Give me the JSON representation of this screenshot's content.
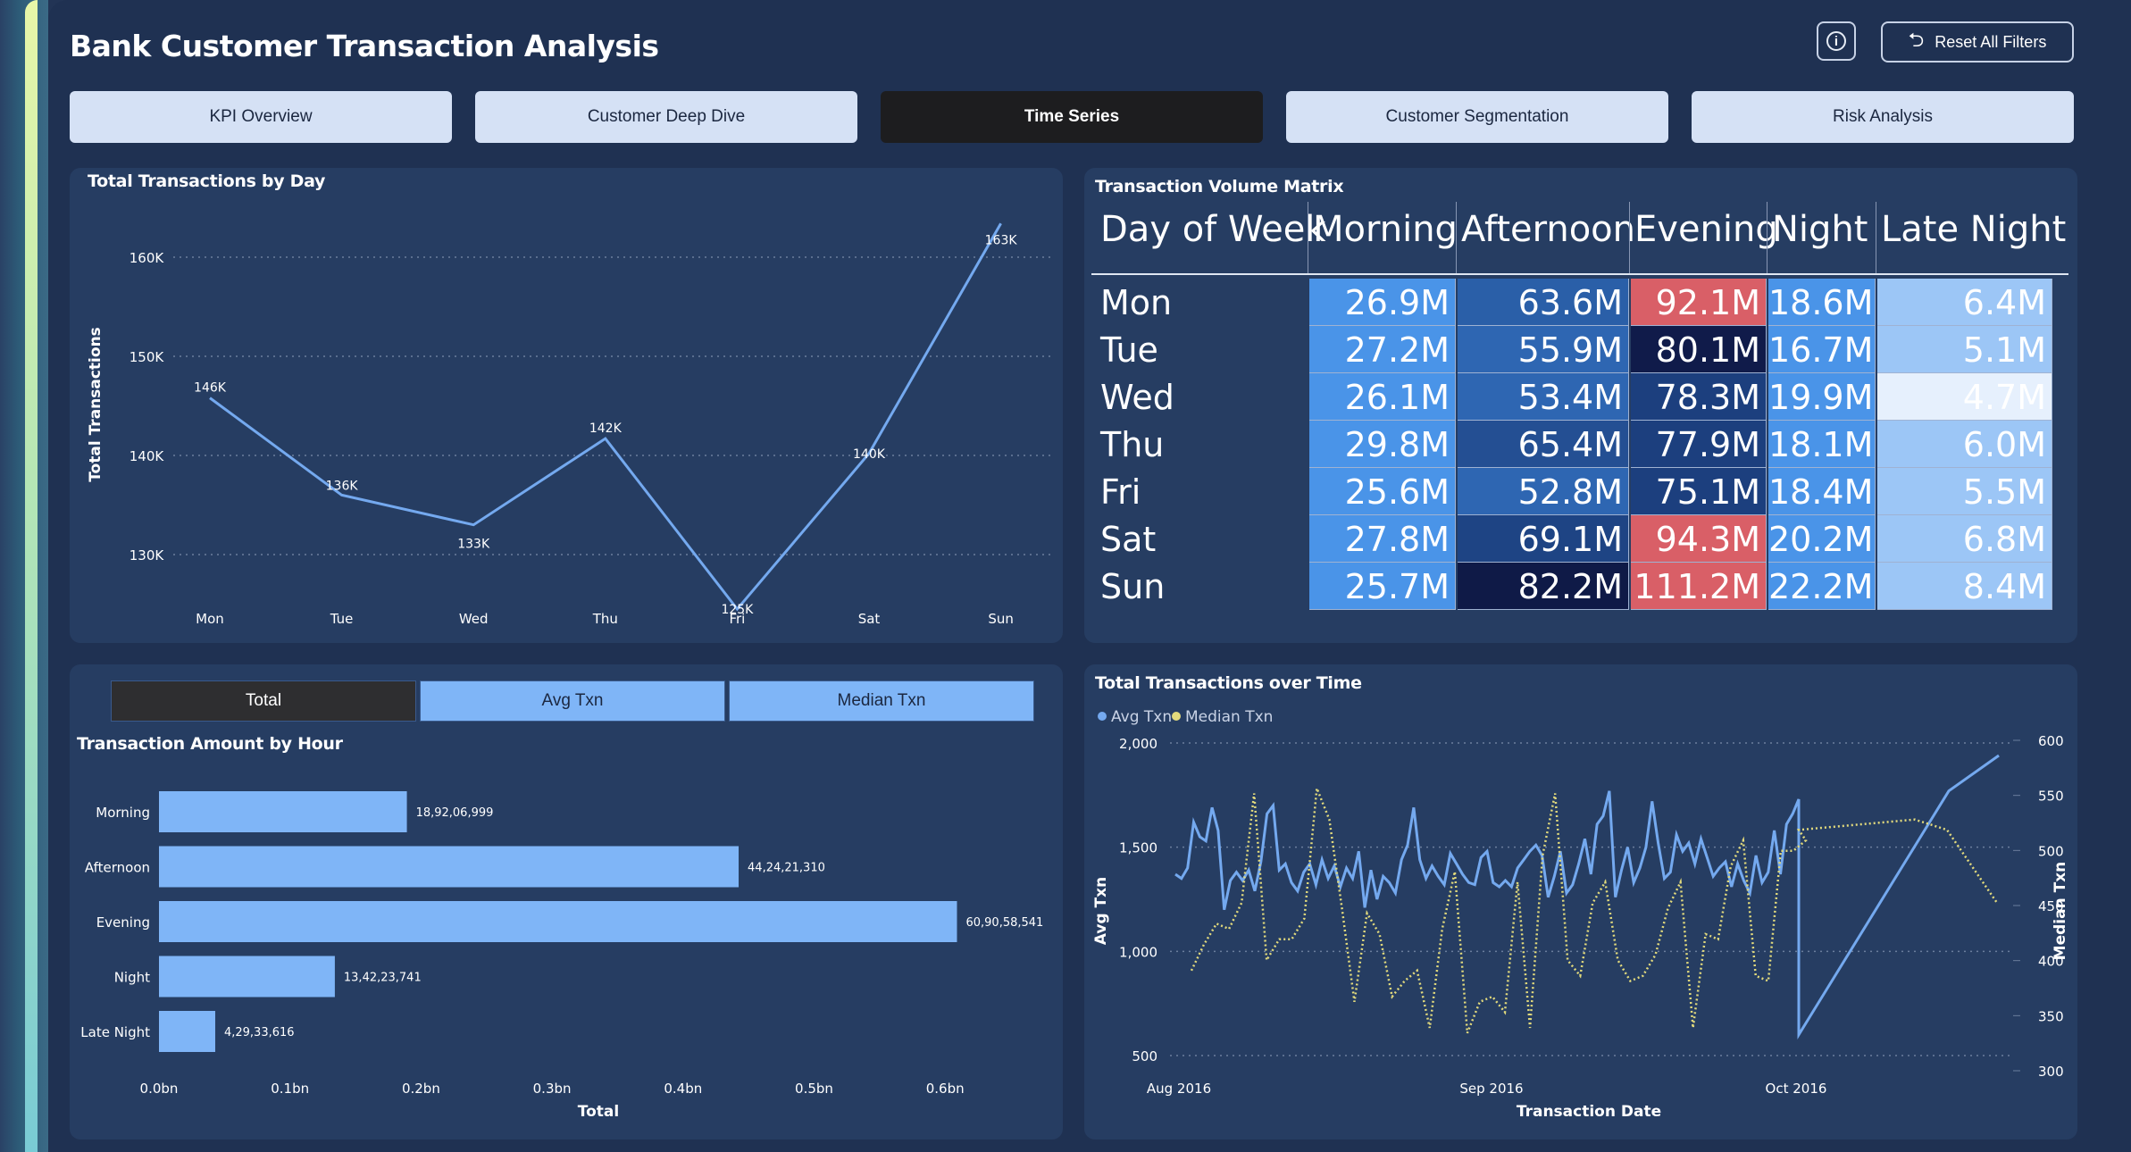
{
  "header": {
    "title": "Bank Customer Transaction Analysis",
    "reset_label": "Reset All Filters",
    "info_glyph": "i"
  },
  "nav": [
    {
      "label": "KPI Overview",
      "active": false
    },
    {
      "label": "Customer Deep Dive",
      "active": false
    },
    {
      "label": "Time Series",
      "active": true
    },
    {
      "label": "Customer Segmentation",
      "active": false
    },
    {
      "label": "Risk Analysis",
      "active": false
    }
  ],
  "day_chart": {
    "title": "Total Transactions by Day",
    "ylabel": "Total Transactions",
    "yticks": [
      "160K",
      "150K",
      "140K",
      "130K"
    ]
  },
  "matrix": {
    "title": "Transaction Volume Matrix",
    "columns": [
      "Day of Week",
      "Morning",
      "Afternoon",
      "Evening",
      "Night",
      "Late Night"
    ],
    "rows": [
      {
        "day": "Mon",
        "values": [
          "26.9M",
          "63.6M",
          "92.1M",
          "18.6M",
          "6.4M"
        ]
      },
      {
        "day": "Tue",
        "values": [
          "27.2M",
          "55.9M",
          "80.1M",
          "16.7M",
          "5.1M"
        ]
      },
      {
        "day": "Wed",
        "values": [
          "26.1M",
          "53.4M",
          "78.3M",
          "19.9M",
          "4.7M"
        ]
      },
      {
        "day": "Thu",
        "values": [
          "29.8M",
          "65.4M",
          "77.9M",
          "18.1M",
          "6.0M"
        ]
      },
      {
        "day": "Fri",
        "values": [
          "25.6M",
          "52.8M",
          "75.1M",
          "18.4M",
          "5.5M"
        ]
      },
      {
        "day": "Sat",
        "values": [
          "27.8M",
          "69.1M",
          "94.3M",
          "20.2M",
          "6.8M"
        ]
      },
      {
        "day": "Sun",
        "values": [
          "25.7M",
          "82.2M",
          "111.2M",
          "22.2M",
          "8.4M"
        ]
      }
    ],
    "colors": [
      [
        "#4a94e8",
        "#2a5fa8",
        "#d95f67",
        "#4a94e8",
        "#9cc6f6"
      ],
      [
        "#4a94e8",
        "#2e66b2",
        "#101b4a",
        "#4a94e8",
        "#9cc6f6"
      ],
      [
        "#4a94e8",
        "#2e66b2",
        "#1c3f7e",
        "#4a94e8",
        "#e6f0fd"
      ],
      [
        "#4a94e8",
        "#244f93",
        "#1c3f7e",
        "#4a94e8",
        "#9cc6f6"
      ],
      [
        "#4a94e8",
        "#2e66b2",
        "#1c3f7e",
        "#4a94e8",
        "#9cc6f6"
      ],
      [
        "#4a94e8",
        "#1e4484",
        "#d95f67",
        "#4a94e8",
        "#9cc6f6"
      ],
      [
        "#4a94e8",
        "#0f1a47",
        "#d95f67",
        "#4a94e8",
        "#9cc6f6"
      ]
    ]
  },
  "toggles": [
    {
      "label": "Total",
      "active": true
    },
    {
      "label": "Avg Txn",
      "active": false
    },
    {
      "label": "Median Txn",
      "active": false
    }
  ],
  "hour_chart": {
    "title": "Transaction Amount by Hour",
    "xlabel": "Total",
    "xticks": [
      "0.0bn",
      "0.1bn",
      "0.2bn",
      "0.3bn",
      "0.4bn",
      "0.5bn",
      "0.6bn"
    ],
    "bar_color": "#7fb5f7"
  },
  "time_chart": {
    "title": "Total Transactions over Time",
    "legend": [
      {
        "label": "Avg Txn",
        "color": "#74a9ef"
      },
      {
        "label": "Median Txn",
        "color": "#e2da7c"
      }
    ],
    "left_ticks": [
      "2,000",
      "1,500",
      "1,000",
      "500"
    ],
    "right_ticks": [
      "600",
      "550",
      "500",
      "450",
      "400",
      "350",
      "300"
    ],
    "xticks": [
      "Aug 2016",
      "Sep 2016",
      "Oct 2016"
    ],
    "xlabel": "Transaction Date",
    "ylabel_left": "Avg Txn",
    "ylabel_right": "Median Txn"
  },
  "chart_data": [
    {
      "type": "line",
      "title": "Total Transactions by Day",
      "ylabel": "Total Transactions",
      "categories": [
        "Mon",
        "Tue",
        "Wed",
        "Thu",
        "Fri",
        "Sat",
        "Sun"
      ],
      "values": [
        145800,
        136000,
        133000,
        141700,
        124500,
        140200,
        163400
      ],
      "labels": [
        "146K",
        "136K",
        "133K",
        "142K",
        "125K",
        "140K",
        "163K"
      ],
      "ylim": [
        126000,
        163000
      ],
      "color": "#74a9ef"
    },
    {
      "type": "bar",
      "orientation": "horizontal",
      "title": "Transaction Amount by Hour",
      "xlabel": "Total",
      "categories": [
        "Morning",
        "Afternoon",
        "Evening",
        "Night",
        "Late Night"
      ],
      "values": [
        189206999,
        442421310,
        609058541,
        134223741,
        42933616
      ],
      "labels": [
        "18,92,06,999",
        "44,24,21,310",
        "60,90,58,541",
        "13,42,23,741",
        "4,29,33,616"
      ],
      "xlim": [
        0,
        0.6
      ]
    },
    {
      "type": "line",
      "title": "Total Transactions over Time",
      "xlabel": "Transaction Date",
      "x_range": [
        "2016-08-01",
        "2016-10-22"
      ],
      "series": [
        {
          "name": "Avg Txn",
          "axis": "left",
          "ylim": [
            500,
            2000
          ],
          "values": [
            1370,
            1350,
            1400,
            1620,
            1550,
            1530,
            1690,
            1580,
            1200,
            1340,
            1380,
            1340,
            1390,
            1290,
            1430,
            1660,
            1700,
            1390,
            1420,
            1330,
            1290,
            1380,
            1420,
            1320,
            1440,
            1350,
            1410,
            1310,
            1400,
            1350,
            1480,
            1210,
            1390,
            1250,
            1360,
            1330,
            1280,
            1440,
            1510,
            1690,
            1440,
            1350,
            1410,
            1360,
            1320,
            1470,
            1420,
            1370,
            1330,
            1320,
            1450,
            1480,
            1330,
            1310,
            1340,
            1310,
            1400,
            1440,
            1480,
            1510,
            1460,
            1260,
            1360,
            1480,
            1280,
            1320,
            1420,
            1540,
            1370,
            1610,
            1650,
            1770,
            1260,
            1390,
            1500,
            1330,
            1400,
            1500,
            1720,
            1520,
            1350,
            1380,
            1560,
            1480,
            1520,
            1420,
            1540,
            1450,
            1360,
            1400,
            1430,
            1310,
            1420,
            1340,
            1280,
            1460,
            1330,
            1380,
            1580,
            1370,
            1610,
            1660,
            1730,
            600,
            1770,
            1940
          ]
        },
        {
          "name": "Median Txn",
          "axis": "right",
          "ylim": [
            300,
            600
          ],
          "values": [
            385,
            410,
            430,
            425,
            450,
            555,
            395,
            415,
            415,
            435,
            560,
            530,
            445,
            355,
            440,
            420,
            360,
            375,
            385,
            330,
            425,
            480,
            325,
            355,
            360,
            345,
            470,
            330,
            495,
            555,
            395,
            380,
            450,
            470,
            395,
            375,
            380,
            400,
            445,
            470,
            330,
            420,
            415,
            485,
            510,
            380,
            375,
            500,
            500,
            510,
            520,
            530,
            520,
            450
          ]
        }
      ],
      "left_ticks": [
        500,
        1000,
        1500,
        2000
      ],
      "right_ticks": [
        300,
        350,
        400,
        450,
        500,
        550,
        600
      ]
    }
  ]
}
